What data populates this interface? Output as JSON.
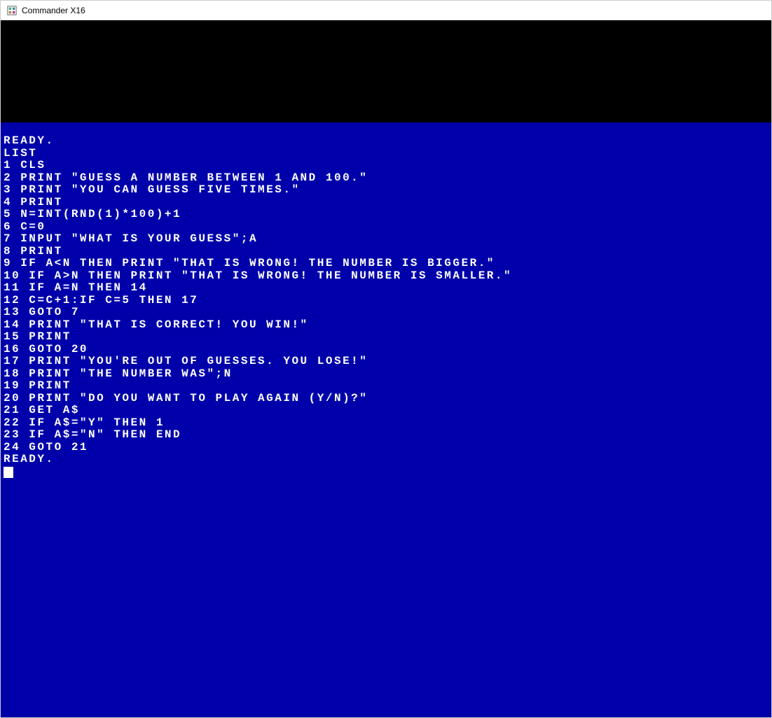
{
  "window": {
    "title": "Commander X16"
  },
  "terminal": {
    "lines": [
      "READY.",
      "LIST",
      "",
      "1 CLS",
      "2 PRINT \"GUESS A NUMBER BETWEEN 1 AND 100.\"",
      "3 PRINT \"YOU CAN GUESS FIVE TIMES.\"",
      "4 PRINT",
      "5 N=INT(RND(1)*100)+1",
      "6 C=0",
      "7 INPUT \"WHAT IS YOUR GUESS\";A",
      "8 PRINT",
      "9 IF A<N THEN PRINT \"THAT IS WRONG! THE NUMBER IS BIGGER.\"",
      "10 IF A>N THEN PRINT \"THAT IS WRONG! THE NUMBER IS SMALLER.\"",
      "11 IF A=N THEN 14",
      "12 C=C+1:IF C=5 THEN 17",
      "13 GOTO 7",
      "14 PRINT \"THAT IS CORRECT! YOU WIN!\"",
      "15 PRINT",
      "16 GOTO 20",
      "17 PRINT \"YOU'RE OUT OF GUESSES. YOU LOSE!\"",
      "18 PRINT \"THE NUMBER WAS\";N",
      "19 PRINT",
      "20 PRINT \"DO YOU WANT TO PLAY AGAIN (Y/N)?\"",
      "21 GET A$",
      "22 IF A$=\"Y\" THEN 1",
      "23 IF A$=\"N\" THEN END",
      "24 GOTO 21",
      "READY."
    ]
  },
  "colors": {
    "terminal_bg": "#0000aa",
    "terminal_fg": "#ffffff",
    "black_bar": "#000000"
  }
}
